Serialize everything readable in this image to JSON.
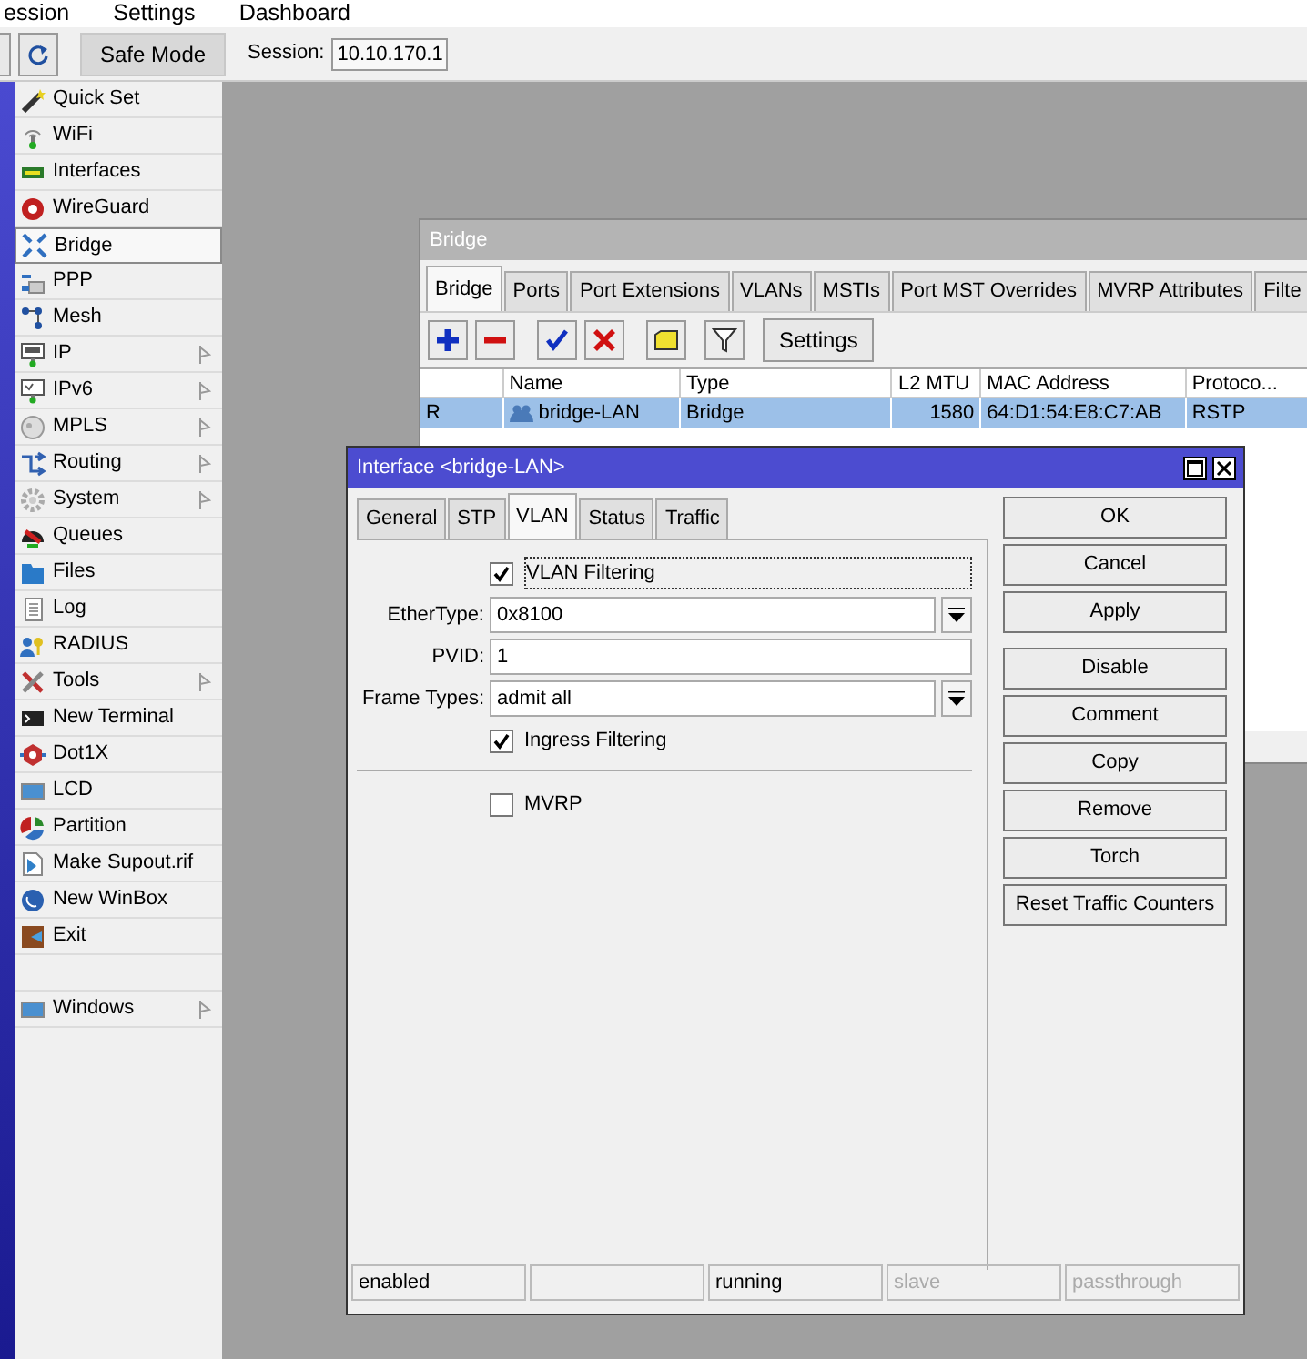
{
  "menu_bar": [
    "ession",
    "Settings",
    "Dashboard"
  ],
  "toolbar": {
    "safe_mode": "Safe Mode",
    "session_label": "Session:",
    "session_value": "10.10.170.1"
  },
  "sidebar": {
    "items": [
      {
        "label": "Quick Set",
        "submenu": false,
        "selected": false
      },
      {
        "label": "WiFi",
        "submenu": false,
        "selected": false
      },
      {
        "label": "Interfaces",
        "submenu": false,
        "selected": false
      },
      {
        "label": "WireGuard",
        "submenu": false,
        "selected": false
      },
      {
        "label": "Bridge",
        "submenu": false,
        "selected": true
      },
      {
        "label": "PPP",
        "submenu": false,
        "selected": false
      },
      {
        "label": "Mesh",
        "submenu": false,
        "selected": false
      },
      {
        "label": "IP",
        "submenu": true,
        "selected": false
      },
      {
        "label": "IPv6",
        "submenu": true,
        "selected": false
      },
      {
        "label": "MPLS",
        "submenu": true,
        "selected": false
      },
      {
        "label": "Routing",
        "submenu": true,
        "selected": false
      },
      {
        "label": "System",
        "submenu": true,
        "selected": false
      },
      {
        "label": "Queues",
        "submenu": false,
        "selected": false
      },
      {
        "label": "Files",
        "submenu": false,
        "selected": false
      },
      {
        "label": "Log",
        "submenu": false,
        "selected": false
      },
      {
        "label": "RADIUS",
        "submenu": false,
        "selected": false
      },
      {
        "label": "Tools",
        "submenu": true,
        "selected": false
      },
      {
        "label": "New Terminal",
        "submenu": false,
        "selected": false
      },
      {
        "label": "Dot1X",
        "submenu": false,
        "selected": false
      },
      {
        "label": "LCD",
        "submenu": false,
        "selected": false
      },
      {
        "label": "Partition",
        "submenu": false,
        "selected": false
      },
      {
        "label": "Make Supout.rif",
        "submenu": false,
        "selected": false
      },
      {
        "label": "New WinBox",
        "submenu": false,
        "selected": false
      },
      {
        "label": "Exit",
        "submenu": false,
        "selected": false
      }
    ],
    "bottom_items": [
      {
        "label": "Windows",
        "submenu": true,
        "selected": false
      }
    ]
  },
  "bridge_window": {
    "title": "Bridge",
    "tabs": [
      {
        "label": "Bridge",
        "selected": true
      },
      {
        "label": "Ports",
        "selected": false
      },
      {
        "label": "Port Extensions",
        "selected": false
      },
      {
        "label": "VLANs",
        "selected": false
      },
      {
        "label": "MSTIs",
        "selected": false
      },
      {
        "label": "Port MST Overrides",
        "selected": false
      },
      {
        "label": "MVRP Attributes",
        "selected": false
      },
      {
        "label": "Filte",
        "selected": false
      }
    ],
    "settings_button": "Settings",
    "columns": [
      "Name",
      "Type",
      "L2 MTU",
      "MAC Address",
      "Protoco..."
    ],
    "rows": [
      {
        "flag": "R",
        "name": "bridge-LAN",
        "type": "Bridge",
        "l2_mtu": "1580",
        "mac_address": "64:D1:54:E8:C7:AB",
        "protocol": "RSTP",
        "selected": true
      }
    ]
  },
  "interface_dialog": {
    "title": "Interface <bridge-LAN>",
    "tabs": [
      {
        "label": "General",
        "selected": false
      },
      {
        "label": "STP",
        "selected": false
      },
      {
        "label": "VLAN",
        "selected": true
      },
      {
        "label": "Status",
        "selected": false
      },
      {
        "label": "Traffic",
        "selected": false
      }
    ],
    "fields": [
      {
        "kind": "checkbox",
        "label": "VLAN Filtering",
        "checked": true
      },
      {
        "kind": "dropdown",
        "label": "EtherType:",
        "value": "0x8100"
      },
      {
        "kind": "text",
        "label": "PVID:",
        "value": "1"
      },
      {
        "kind": "dropdown",
        "label": "Frame Types:",
        "value": "admit all"
      },
      {
        "kind": "checkbox",
        "label": "Ingress Filtering",
        "checked": true
      },
      {
        "kind": "separator"
      },
      {
        "kind": "checkbox",
        "label": "MVRP",
        "checked": false
      }
    ],
    "dialog_buttons": [
      "OK",
      "Cancel",
      "Apply"
    ],
    "action_buttons": [
      "Disable",
      "Comment",
      "Copy",
      "Remove",
      "Torch",
      "Reset Traffic Counters"
    ],
    "status_bar": [
      {
        "kind": "text",
        "text": "enabled",
        "disabled": false
      },
      {
        "kind": "blank"
      },
      {
        "kind": "text",
        "text": "running",
        "disabled": false
      },
      {
        "kind": "text",
        "text": "slave",
        "disabled": true
      },
      {
        "kind": "text",
        "text": "passthrough",
        "disabled": true
      }
    ]
  }
}
